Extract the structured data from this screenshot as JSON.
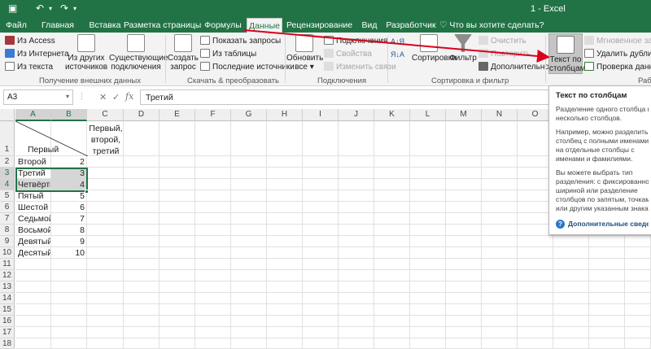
{
  "window": {
    "title": "1 - Excel"
  },
  "quick_access": {
    "save_icon": "save-icon",
    "undo_icon": "undo-icon",
    "redo_icon": "redo-icon"
  },
  "tabs": [
    {
      "label": "Файл"
    },
    {
      "label": "Главная"
    },
    {
      "label": "Вставка"
    },
    {
      "label": "Разметка страницы"
    },
    {
      "label": "Формулы"
    },
    {
      "label": "Данные"
    },
    {
      "label": "Рецензирование"
    },
    {
      "label": "Вид"
    },
    {
      "label": "Разработчик"
    }
  ],
  "tell_me": "Что вы хотите сделать?",
  "ribbon": {
    "external": {
      "from_access": "Из Access",
      "from_web": "Из Интернета",
      "from_text": "Из текста",
      "other_sources_l1": "Из других",
      "other_sources_l2": "источников",
      "existing_l1": "Существующие",
      "existing_l2": "подключения",
      "group": "Получение внешних данных"
    },
    "transform": {
      "new_query_l1": "Создать",
      "new_query_l2": "запрос",
      "show_queries": "Показать запросы",
      "from_table": "Из таблицы",
      "recent_sources": "Последние источники",
      "group": "Скачать & преобразовать"
    },
    "connections": {
      "refresh_l1": "Обновить",
      "refresh_l2": "все",
      "connections": "Подключения",
      "properties": "Свойства",
      "edit_links": "Изменить связи",
      "group": "Подключения"
    },
    "sort_filter": {
      "sort": "Сортировка",
      "filter": "Фильтр",
      "clear": "Очистить",
      "reapply": "Повторить",
      "advanced": "Дополнительно",
      "group": "Сортировка и фильтр"
    },
    "data_tools": {
      "text_to_columns_l1": "Текст по",
      "text_to_columns_l2": "столбцам",
      "flash_fill": "Мгновенное запол",
      "remove_duplicates": "Удалить дубликат",
      "data_validation": "Проверка данных",
      "group": "Рабо"
    }
  },
  "formula_bar": {
    "name_box": "A3",
    "cancel": "✕",
    "enter": "✓",
    "fx": "fx",
    "value": "Третий"
  },
  "grid": {
    "columns": [
      "A",
      "B",
      "C",
      "D",
      "E",
      "F",
      "G",
      "H",
      "I",
      "J",
      "K",
      "L",
      "M",
      "N",
      "O"
    ],
    "rows": [
      "1",
      "2",
      "3",
      "4",
      "5",
      "6",
      "7",
      "8",
      "9",
      "10",
      "11",
      "12",
      "13",
      "14",
      "15",
      "16",
      "17",
      "18"
    ],
    "c1_lines": [
      "Первый,",
      "второй,",
      "третий"
    ],
    "a1": "Первый",
    "cells": [
      {
        "a": "Второй",
        "b": "2"
      },
      {
        "a": "Третий",
        "b": "3"
      },
      {
        "a": "Четвёрты",
        "b": "4"
      },
      {
        "a": "Пятый",
        "b": "5"
      },
      {
        "a": "Шестой",
        "b": "6"
      },
      {
        "a": "Седьмой",
        "b": "7"
      },
      {
        "a": "Восьмой",
        "b": "8"
      },
      {
        "a": "Девятый",
        "b": "9"
      },
      {
        "a": "Десятый",
        "b": "10"
      }
    ]
  },
  "tooltip": {
    "title": "Текст по столбцам",
    "p1": [
      "Разделение одного столбца на",
      "несколько столбцов."
    ],
    "p2": [
      "Например, можно разделить",
      "столбец с полными именами",
      "на отдельные столбцы с",
      "именами и фамилиями."
    ],
    "p3": [
      "Вы можете выбрать тип",
      "разделения: с фиксированной",
      "шириной или разделение",
      "столбцов по запятым, точкам",
      "или другим указанным знакам."
    ],
    "more": "Дополнительные сведения"
  },
  "colors": {
    "accent": "#217346",
    "arrow": "#d9001b",
    "selection": "#d6d6d6"
  }
}
